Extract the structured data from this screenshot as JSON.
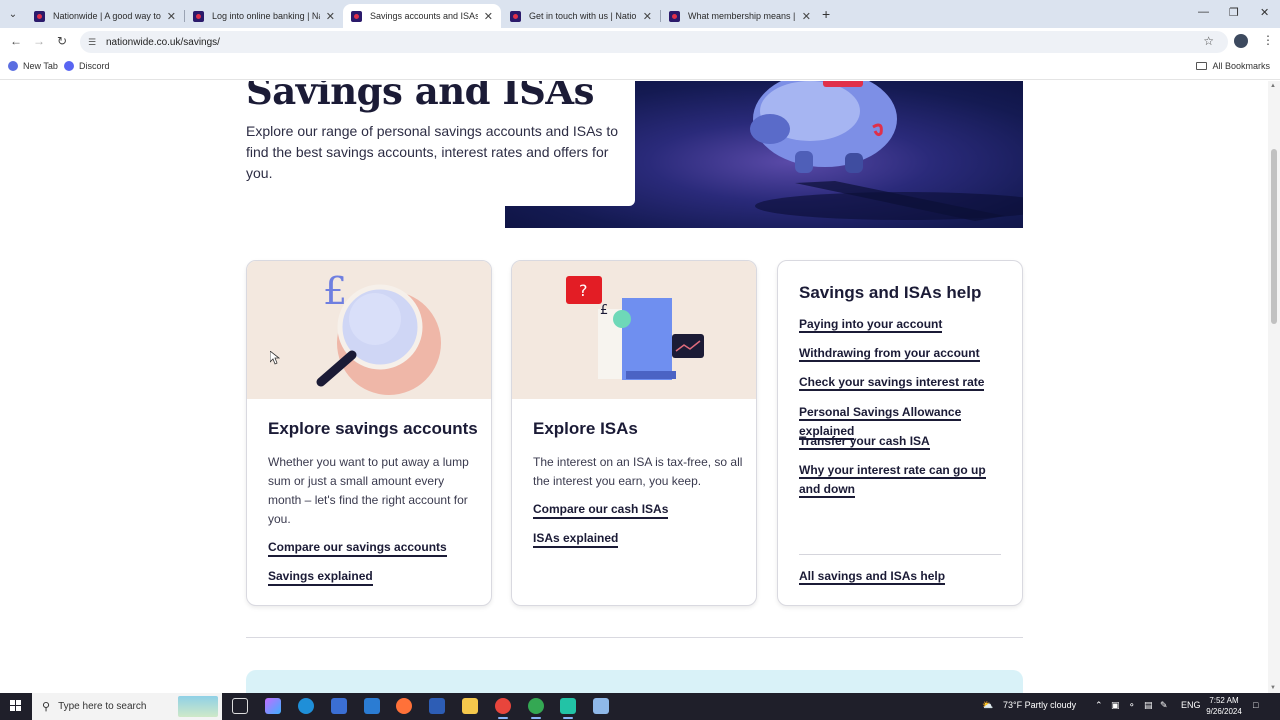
{
  "browser": {
    "tabs": [
      {
        "title": "Nationwide | A good way to ba",
        "active": false
      },
      {
        "title": "Log into online banking | Natio",
        "active": false
      },
      {
        "title": "Savings accounts and ISAs | Nat",
        "active": true
      },
      {
        "title": "Get in touch with us | Nationwi",
        "active": false
      },
      {
        "title": "What membership means | Nat",
        "active": false
      }
    ],
    "url": "nationwide.co.uk/savings/",
    "bookmarks": [
      {
        "label": "New Tab",
        "color": "#5b6ee1"
      },
      {
        "label": "Discord",
        "color": "#5865f2"
      }
    ],
    "all_bookmarks": "All Bookmarks"
  },
  "hero": {
    "title": "Savings and ISAs",
    "text": "Explore our range of personal savings accounts and ISAs to find the best savings accounts, interest rates and offers for you."
  },
  "cards": [
    {
      "title": "Explore savings accounts",
      "description": "Whether you want to put away a lump sum or just a small amount every month – let's find the right account for you.",
      "links": [
        "Compare our savings accounts",
        "Savings explained"
      ]
    },
    {
      "title": "Explore ISAs",
      "description": "The interest on an ISA is tax-free, so all the interest you earn, you keep.",
      "links": [
        "Compare our cash ISAs",
        "ISAs explained"
      ]
    }
  ],
  "help": {
    "title": "Savings and ISAs help",
    "links": [
      "Paying into your account",
      "Withdrawing from your account",
      "Check your savings interest rate",
      "Personal Savings Allowance explained",
      "Transfer your cash ISA",
      "Why your interest rate can go up and down"
    ],
    "all_link": "All savings and ISAs help"
  },
  "illustration": {
    "pound_symbol": "£",
    "question_mark": "?"
  },
  "taskbar": {
    "search_placeholder": "Type here to search",
    "weather": "73°F  Partly cloudy",
    "language": "ENG",
    "time": "7:52 AM",
    "date": "9/26/2024"
  },
  "colors": {
    "brand_navy": "#1b1b36",
    "hero_bg": "#141a52",
    "card_illustration_bg": "#f3e8df",
    "accent_red": "#e0304a"
  }
}
